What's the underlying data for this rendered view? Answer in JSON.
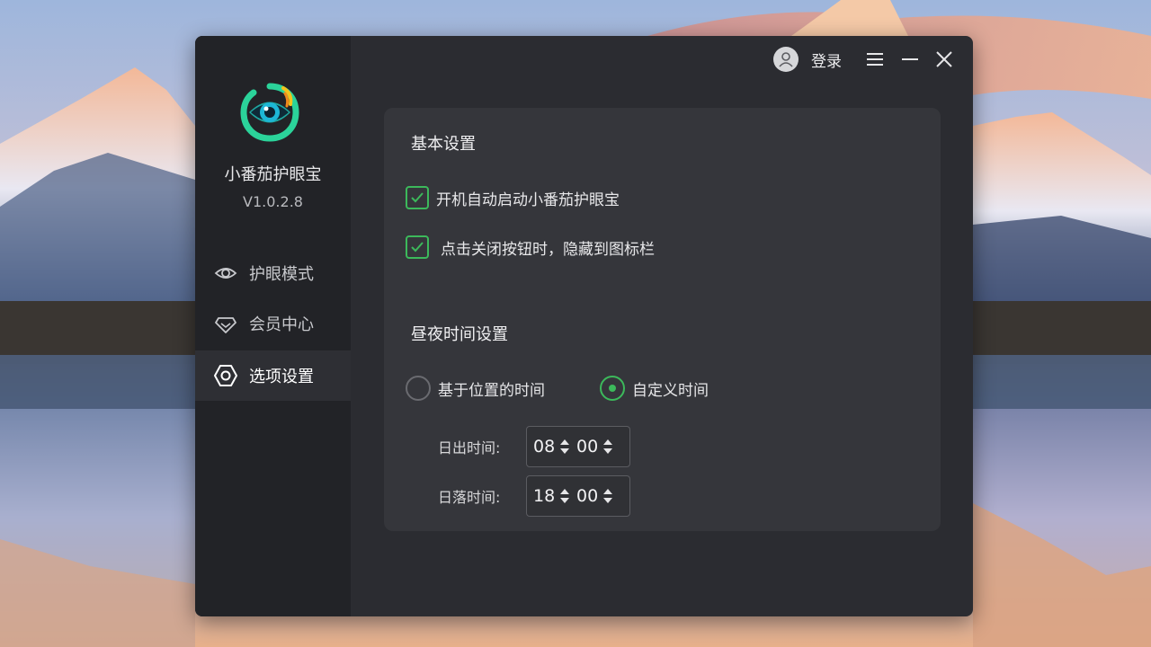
{
  "app": {
    "name": "小番茄护眼宝",
    "version": "V1.0.2.8"
  },
  "titlebar": {
    "login_label": "登录"
  },
  "sidebar": {
    "items": [
      {
        "label": "护眼模式",
        "icon": "eye-icon",
        "active": false
      },
      {
        "label": "会员中心",
        "icon": "diamond-icon",
        "active": false
      },
      {
        "label": "选项设置",
        "icon": "settings-hexagon-icon",
        "active": true
      }
    ]
  },
  "basic_settings": {
    "title": "基本设置",
    "options": [
      {
        "label": "开机自动启动小番茄护眼宝",
        "checked": true
      },
      {
        "label": "点击关闭按钮时，隐藏到图标栏",
        "checked": true
      }
    ]
  },
  "day_night": {
    "title": "昼夜时间设置",
    "modes": [
      {
        "label": "基于位置的时间",
        "selected": false
      },
      {
        "label": "自定义时间",
        "selected": true
      }
    ],
    "sunrise": {
      "label": "日出时间:",
      "hour": "08",
      "minute": "00"
    },
    "sunset": {
      "label": "日落时间:",
      "hour": "18",
      "minute": "00"
    }
  },
  "colors": {
    "accent": "#3cb95b",
    "window_bg": "#2b2c31",
    "sidebar_bg": "#222327",
    "card_bg": "#35363b"
  }
}
